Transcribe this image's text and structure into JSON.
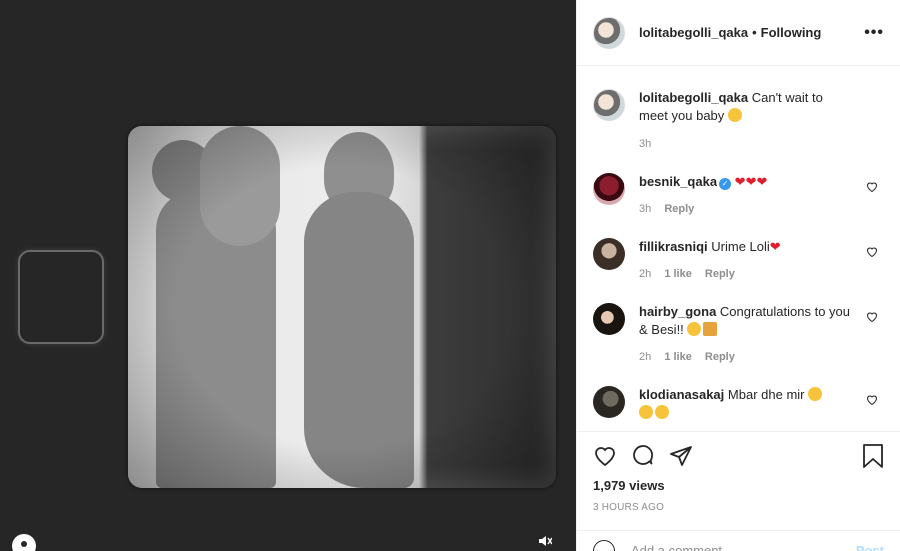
{
  "post": {
    "author": "lolitabegolli_qaka",
    "follow_status": "Following",
    "separator": "•",
    "more_glyph": "•••",
    "caption": "Can't wait to meet you baby",
    "caption_time": "3h"
  },
  "comments": [
    {
      "user": "besnik_qaka",
      "verified": true,
      "text": "",
      "emoji": "❤❤❤",
      "time": "3h",
      "likes": "",
      "reply": "Reply"
    },
    {
      "user": "fillikrasniqi",
      "verified": false,
      "text": "Urime Loli",
      "emoji": "❤",
      "time": "2h",
      "likes": "1 like",
      "reply": "Reply"
    },
    {
      "user": "hairby_gona",
      "verified": false,
      "text": "Congratulations to you & Besi!!",
      "emoji": "",
      "time": "2h",
      "likes": "1 like",
      "reply": "Reply"
    },
    {
      "user": "klodianasakaj",
      "verified": false,
      "text": "Mbar dhe mir",
      "emoji": "",
      "time": "",
      "likes": "",
      "reply": ""
    }
  ],
  "actions": {
    "views": "1,979 views",
    "posted_ago": "3 HOURS AGO"
  },
  "add_comment": {
    "placeholder": "Add a comment...",
    "post_label": "Post"
  },
  "colors": {
    "link_blue": "#3897f0",
    "post_disabled": "#b2dffc",
    "heart_red": "#e0202f"
  }
}
